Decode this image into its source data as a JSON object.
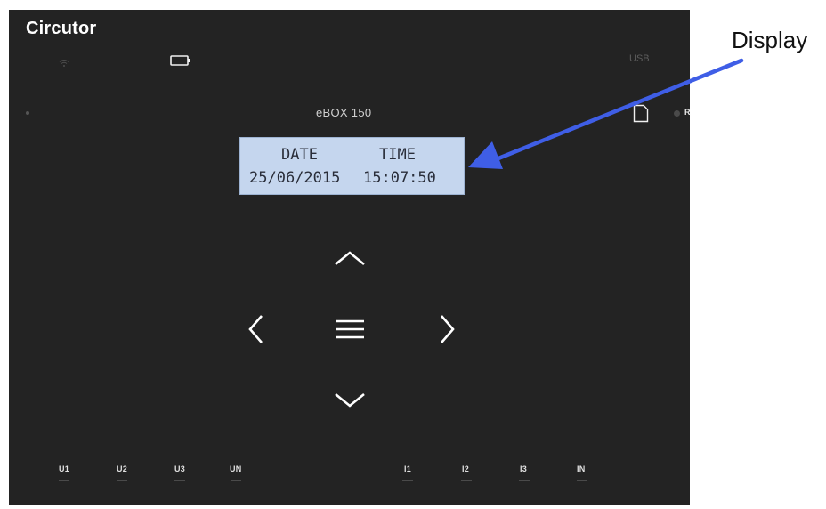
{
  "device": {
    "brand": "Circutor",
    "model": "ēBOX 150",
    "usb_label": "USB",
    "reset_label": "R",
    "icons": {
      "wifi": "wifi-icon",
      "battery": "battery-icon",
      "sd_card": "sd-card-icon",
      "up": "chevron-up-icon",
      "down": "chevron-down-icon",
      "left": "chevron-left-icon",
      "right": "chevron-right-icon",
      "menu": "menu-icon"
    }
  },
  "display": {
    "line1_left": "DATE",
    "line1_right": "TIME",
    "line2_left": "25/06/2015",
    "line2_right": "15:07:50"
  },
  "ports": {
    "voltage": [
      "U1",
      "U2",
      "U3",
      "UN"
    ],
    "current": [
      "I1",
      "I2",
      "I3",
      "IN"
    ]
  },
  "annotation": {
    "label": "Display",
    "arrow_color": "#3f5ee6"
  },
  "colors": {
    "panel": "#232323",
    "lcd_background": "#c5d6ee"
  }
}
